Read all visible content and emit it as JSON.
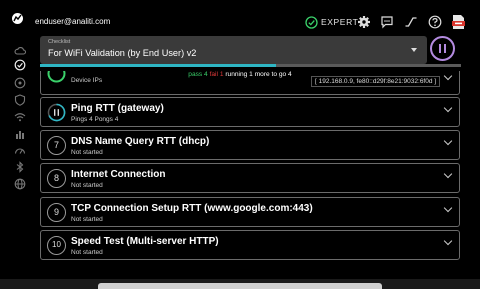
{
  "header": {
    "user": "enduser@analiti.com",
    "expert_label": "EXPERT",
    "icons": [
      "logo-icon",
      "expert-check-icon",
      "settings-gear-icon",
      "feedback-chat-icon",
      "graph-icon",
      "help-icon",
      "pdf-export-icon"
    ]
  },
  "sidebar": {
    "icons": [
      "cloud-icon",
      "checklist-icon",
      "network-icon",
      "shield-icon",
      "wifi-icon",
      "bar-chart-icon",
      "speed-icon",
      "bluetooth-icon",
      "globe-icon"
    ]
  },
  "checklist": {
    "label": "Checklist",
    "value": "For WiFi Validation (by End User) v2",
    "progress": 0.56
  },
  "status": {
    "pass": "pass 4",
    "fail": "fail 1",
    "running": "running 1",
    "more": "more to go 4"
  },
  "items": [
    {
      "number": "",
      "title": "",
      "subtitle": "Device IPs",
      "detail": "[ 192.168.0.9, fe80::d29f:8e21:9032:6f0d ]",
      "state": "pass"
    },
    {
      "number": "",
      "title": "Ping RTT (gateway)",
      "subtitle": "Pings 4 Pongs 4",
      "state": "running"
    },
    {
      "number": "7",
      "title": "DNS Name Query RTT (dhcp)",
      "subtitle": "Not started",
      "state": "pending"
    },
    {
      "number": "8",
      "title": "Internet Connection",
      "subtitle": "Not started",
      "state": "pending"
    },
    {
      "number": "9",
      "title": "TCP Connection Setup RTT (www.google.com:443)",
      "subtitle": "Not started",
      "state": "pending"
    },
    {
      "number": "10",
      "title": "Speed Test (Multi-server HTTP)",
      "subtitle": "Not started",
      "state": "pending"
    }
  ],
  "colors": {
    "accent": "#2fb6c4",
    "pass": "#3ad06a",
    "fail": "#e03a3a",
    "pause": "#b48be0"
  }
}
